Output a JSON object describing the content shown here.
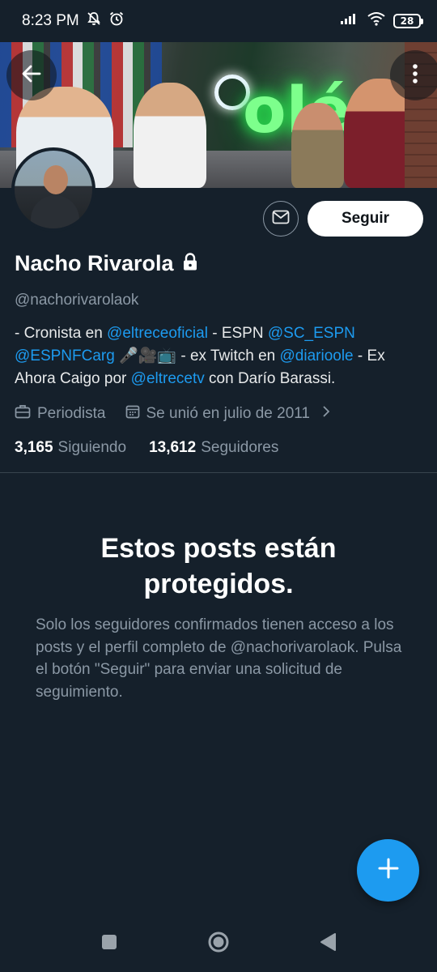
{
  "status_bar": {
    "time": "8:23 PM",
    "icons": [
      "bell-off-icon",
      "alarm-icon",
      "signal-icon",
      "wifi-icon"
    ],
    "battery": "28"
  },
  "header": {
    "back_icon": "arrow-left-icon",
    "more_icon": "more-vertical-icon"
  },
  "profile": {
    "name": "Nacho Rivarola",
    "handle": "@nachorivarolaok",
    "bio": [
      {
        "text": "- Cronista en ",
        "link": false
      },
      {
        "text": "@eltreceoficial",
        "link": true
      },
      {
        "text": " - ESPN ",
        "link": false
      },
      {
        "text": "@SC_ESPN",
        "link": true
      },
      {
        "text": " ",
        "link": false
      },
      {
        "text": "@ESPNFCarg",
        "link": true
      },
      {
        "text": " 🎤🎥📺 - ex Twitch en ",
        "link": false
      },
      {
        "text": "@diarioole",
        "link": true
      },
      {
        "text": " - Ex Ahora Caigo por ",
        "link": false
      },
      {
        "text": "@eltrecetv",
        "link": true
      },
      {
        "text": " con Darío Barassi.",
        "link": false
      }
    ],
    "occupation": "Periodista",
    "joined": "Se unió en julio de 2011",
    "following_count": "3,165",
    "following_label": "Siguiendo",
    "followers_count": "13,612",
    "followers_label": "Seguidores"
  },
  "actions": {
    "follow_label": "Seguir",
    "message_icon": "mail-icon"
  },
  "protected": {
    "title": "Estos posts están protegidos.",
    "text": "Solo los seguidores confirmados tienen acceso a los posts y el perfil completo de @nachorivarolaok. Pulsa el botón \"Seguir\" para enviar una solicitud de seguimiento."
  },
  "colors": {
    "background": "#15202b",
    "accent": "#1d9bf0",
    "muted": "#8b98a5"
  }
}
